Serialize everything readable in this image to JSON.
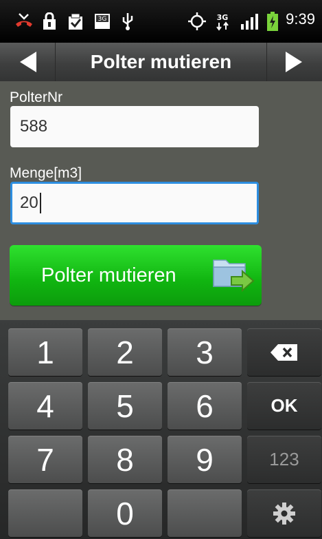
{
  "status_bar": {
    "time": "9:39",
    "network_label": "3G",
    "icons": [
      "missed-call-icon",
      "lock-icon",
      "checkbox-icon",
      "3g-data-icon",
      "usb-icon",
      "gps-icon",
      "network-3g-icon",
      "signal-icon",
      "battery-charging-icon"
    ]
  },
  "title_bar": {
    "title": "Polter mutieren",
    "left_icon": "arrow-left-icon",
    "right_icon": "arrow-right-icon"
  },
  "form": {
    "polter_label": "PolterNr",
    "polter_value": "588",
    "menge_label": "Menge[m3]",
    "menge_value": "20",
    "submit_label": "Polter mutieren",
    "submit_icon": "folder-export-icon"
  },
  "keyboard": {
    "rows": [
      [
        "1",
        "2",
        "3",
        "backspace"
      ],
      [
        "4",
        "5",
        "6",
        "OK"
      ],
      [
        "7",
        "8",
        "9",
        "123"
      ],
      [
        "",
        "0",
        "",
        "settings"
      ]
    ],
    "ok_label": "OK",
    "mode_label": "123"
  },
  "colors": {
    "accent_green": "#16c016",
    "focus_blue": "#2d8ee0",
    "content_bg": "#585a54"
  }
}
